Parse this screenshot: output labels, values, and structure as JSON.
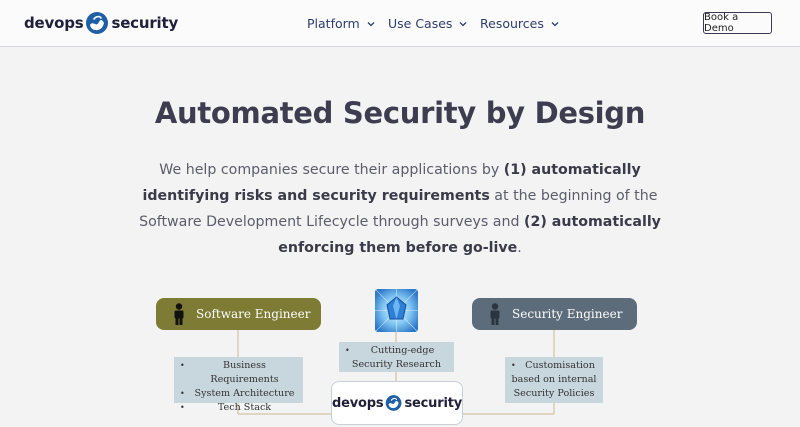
{
  "header": {
    "logo": {
      "word1": "devops",
      "word2": "security",
      "icon": "shield-wave-logo"
    },
    "nav": [
      {
        "label": "Platform",
        "icon": "chevron-down-icon"
      },
      {
        "label": "Use Cases",
        "icon": "chevron-down-icon"
      },
      {
        "label": "Resources",
        "icon": "chevron-down-icon"
      }
    ],
    "cta_label": "Book a Demo"
  },
  "hero": {
    "title": "Automated Security by Design",
    "sub_1": "We help companies secure their applications by ",
    "sub_2": "(1) automatically identifying risks and security requirements",
    "sub_3": " at the beginning of the Software Development Lifecycle through surveys and ",
    "sub_4": "(2) automatically enforcing them before go-live",
    "sub_5": "."
  },
  "diagram": {
    "left": {
      "title": "Software Engineer",
      "icon": "person-icon",
      "items": [
        "Business Requirements",
        "System Architecture",
        "Tech Stack"
      ]
    },
    "right": {
      "title": "Security Engineer",
      "icon": "person-icon",
      "items": [
        "Customisation",
        "based on internal",
        "Security Policies"
      ]
    },
    "middle": {
      "icon": "crystal-icon",
      "items": [
        "Cutting-edge",
        "Security Research"
      ]
    },
    "center": {
      "word1": "devops",
      "word2": "security"
    }
  },
  "colors": {
    "software_engineer": "#7d7b34",
    "security_engineer": "#5c6c7a",
    "info_box": "#c8d6dd",
    "logo_blue": "#1f5fa6"
  }
}
